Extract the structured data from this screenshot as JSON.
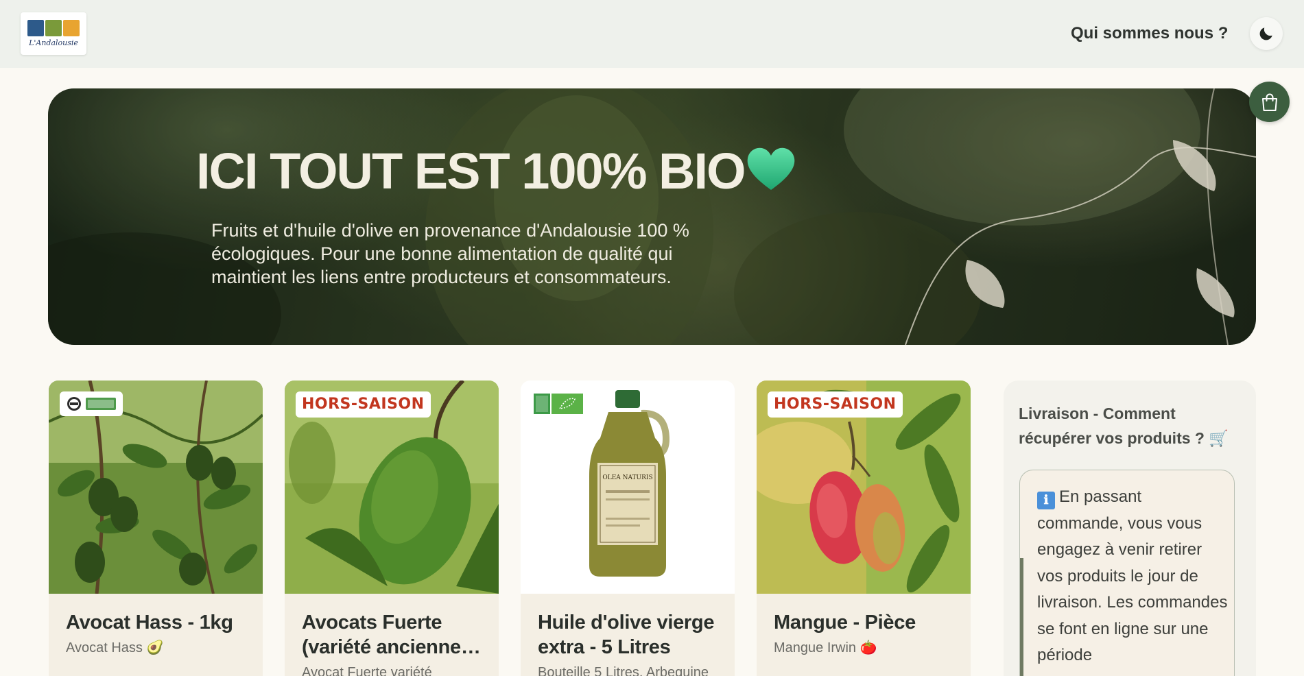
{
  "header": {
    "logo_text": "L'Andalousie",
    "nav_link": "Qui sommes nous ?",
    "theme_toggle_icon": "moon-icon"
  },
  "hero": {
    "title": "ICI TOUT EST 100% BIO",
    "heart_icon": "green-heart-icon",
    "subtitle": "Fruits et d'huile d'olive en provenance d'Andalousie 100 % écologiques. Pour une bonne alimentation de qualité qui maintient les liens entre producteurs et consommateurs.",
    "cart_icon": "shopping-bag-icon"
  },
  "products": [
    {
      "title": "Avocat Hass - 1kg",
      "description": "Avocat Hass 🥑",
      "badge": "",
      "badge_type": "bio-label",
      "image": "avocado-tree"
    },
    {
      "title": "Avocats Fuerte (variété ancienne…",
      "description": "Avocat Fuerte variété",
      "badge": "HORS-SAISON",
      "badge_type": "off-season",
      "image": "avocado-close"
    },
    {
      "title": "Huile d'olive vierge extra - 5 Litres",
      "description": "Bouteille 5 Litres. Arbequine",
      "badge": "",
      "badge_type": "eu-organic-label",
      "image": "olive-oil-bottle",
      "bottle_label": "OLEA NATURIS"
    },
    {
      "title": "Mangue - Pièce",
      "description": "Mangue Irwin 🍅",
      "badge": "HORS-SAISON",
      "badge_type": "off-season",
      "image": "mango"
    }
  ],
  "delivery_panel": {
    "title": "Livraison - Comment récupérer vos produits ? 🛒",
    "info_icon": "ℹ",
    "text": "En passant commande, vous vous engagez à venir retirer vos produits le jour de livraison. Les commandes se font en ligne sur une période"
  },
  "colors": {
    "header_bg": "#eef1ec",
    "page_bg": "#fbf9f3",
    "cart_button": "#3c5e3f",
    "badge_text": "#c2361f",
    "heart": "#3cc98c"
  }
}
